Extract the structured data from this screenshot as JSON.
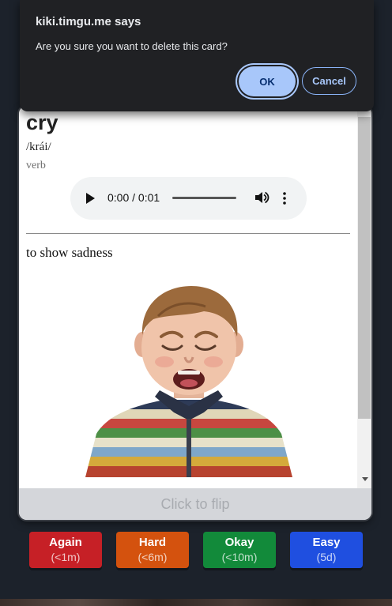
{
  "dialog": {
    "title": "kiki.timgu.me says",
    "message": "Are you sure you want to delete this card?",
    "ok_label": "OK",
    "cancel_label": "Cancel"
  },
  "card": {
    "word": "cry",
    "phonetic": "/krái/",
    "part_of_speech": "verb",
    "audio": {
      "time": "0:00 / 0:01"
    },
    "definition": "to show sadness",
    "image_icon": "crying-child-illustration",
    "flip_label": "Click to flip"
  },
  "ratings": [
    {
      "label": "Again",
      "interval": "(<1m)",
      "color": "#c62026"
    },
    {
      "label": "Hard",
      "interval": "(<6m)",
      "color": "#d4520e"
    },
    {
      "label": "Okay",
      "interval": "(<10m)",
      "color": "#128a3a"
    },
    {
      "label": "Easy",
      "interval": "(5d)",
      "color": "#1f4fe0"
    }
  ]
}
